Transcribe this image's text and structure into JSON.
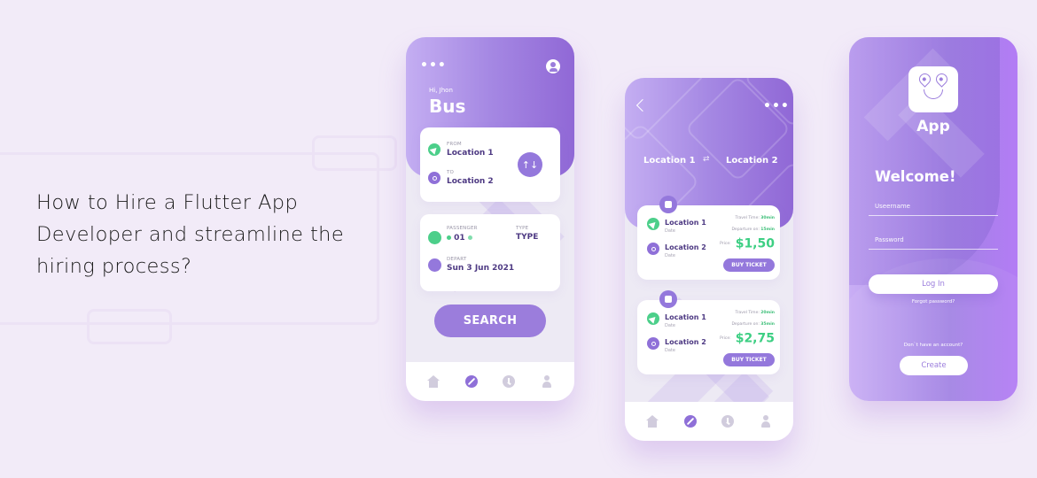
{
  "headline": "How to Hire a Flutter App Developer and streamline the hiring process?",
  "colors": {
    "background": "#f2ebf8",
    "primary_purple": "#9b7ddc",
    "accent_green": "#4ccf8a",
    "dark_text": "#4e3a83"
  },
  "phone_search": {
    "menu_icon": "more-dots-icon",
    "profile_icon": "user-icon",
    "greeting": "Hi, Jhon",
    "title": "Bus",
    "from_label": "FROM",
    "from_value": "Location 1",
    "to_label": "TO",
    "to_value": "Location 2",
    "swap_icon": "swap-arrows-icon",
    "swap_glyph": "↑↓",
    "passenger_label": "PASSENGER",
    "passenger_value": "01",
    "type_label": "TYPE",
    "type_value": "TYPE",
    "depart_label": "DEPART",
    "depart_value": "Sun 3 Jun 2021",
    "search_label": "SEARCH",
    "nav": [
      "home",
      "explore",
      "history",
      "profile"
    ],
    "active_nav": "explore"
  },
  "phone_results": {
    "back_icon": "back-chevron-icon",
    "menu_icon": "more-dots-icon",
    "route_from": "Location 1",
    "route_to": "Location 2",
    "route_swap_glyph": "⇄",
    "tickets": [
      {
        "from": "Location 1",
        "from_sub": "Date",
        "to": "Location 2",
        "to_sub": "Date",
        "travel_time_label": "Travel Time:",
        "travel_time": "30min",
        "departure_label": "Departure on:",
        "departure": "15min",
        "price_label": "Price:",
        "price": "$1,50",
        "button": "BUY TICKET"
      },
      {
        "from": "Location 1",
        "from_sub": "Date",
        "to": "Location 2",
        "to_sub": "Date",
        "travel_time_label": "Travel Time:",
        "travel_time": "20min",
        "departure_label": "Departure on:",
        "departure": "35min",
        "price_label": "Price:",
        "price": "$2,75",
        "button": "BUY TICKET"
      }
    ],
    "nav": [
      "home",
      "explore",
      "history",
      "profile"
    ],
    "active_nav": "explore"
  },
  "phone_login": {
    "app_name": "App",
    "welcome": "Welcome!",
    "username_placeholder": "Useername",
    "password_placeholder": "Password",
    "login_label": "Log In",
    "forgot_label": "Forgot password?",
    "no_account_label": "Don`t have an account?",
    "create_label": "Create"
  }
}
